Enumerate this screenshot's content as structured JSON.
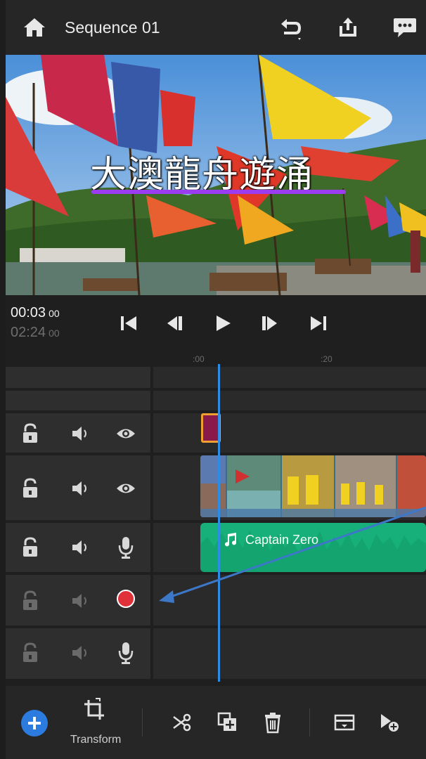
{
  "header": {
    "title": "Sequence 01",
    "home_icon": "home-icon",
    "undo_icon": "undo-icon",
    "share_icon": "share-icon",
    "comment_icon": "comment-icon"
  },
  "preview": {
    "overlay_text": "大澳龍舟遊涌",
    "underline_color": "#9b3cf0"
  },
  "transport": {
    "current_time": "00:03",
    "current_frames": "00",
    "total_time": "02:24",
    "total_frames": "00"
  },
  "ruler": {
    "tick_start": ":00",
    "tick_mid": ":20"
  },
  "tracks": [
    {
      "name": "title-track",
      "icons": [
        "lock-icon",
        "speaker-icon",
        "eye-icon"
      ]
    },
    {
      "name": "video-track",
      "icons": [
        "lock-icon",
        "speaker-icon",
        "eye-icon"
      ]
    },
    {
      "name": "audio-track-1",
      "icons": [
        "lock-icon",
        "speaker-icon",
        "microphone-icon"
      ]
    },
    {
      "name": "audio-track-2",
      "icons": [
        "lock-icon",
        "speaker-icon",
        "record-icon"
      ]
    },
    {
      "name": "audio-track-3",
      "icons": [
        "lock-icon",
        "speaker-icon",
        "microphone-icon"
      ]
    }
  ],
  "clips": {
    "audio_label": "Captain Zero"
  },
  "bottombar": {
    "transform_label": "Transform",
    "icons": [
      "add-icon",
      "transform-icon",
      "scissors-icon",
      "duplicate-icon",
      "delete-icon",
      "fill-icon",
      "add-media-icon"
    ]
  },
  "colors": {
    "accent": "#2c7ce0",
    "playhead": "#2d8ce6",
    "audio_clip": "#17b07a",
    "record": "#e0303a",
    "title_clip_border": "#f0a030"
  }
}
